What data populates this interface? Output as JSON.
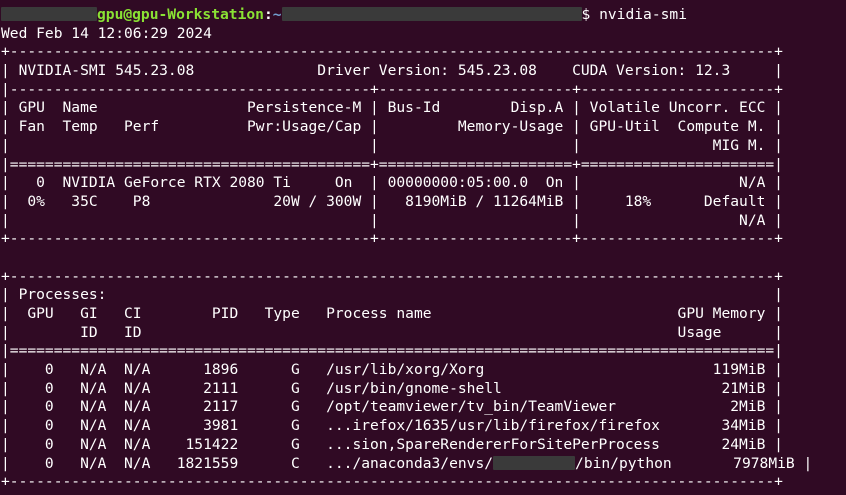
{
  "prompt": {
    "user_host": "gpu@gpu-Workstation",
    "separator": ":",
    "path_prefix": "~",
    "dollar": "$",
    "command": " nvidia-smi"
  },
  "date_line": "Wed Feb 14 12:06:29 2024",
  "lines": {
    "border_top": "+---------------------------------------------------------------------------------------+",
    "header": "| NVIDIA-SMI 545.23.08              Driver Version: 545.23.08    CUDA Version: 12.3     |",
    "sep1": "|-----------------------------------------+----------------------+----------------------+",
    "col_head_1": "| GPU  Name                 Persistence-M | Bus-Id        Disp.A | Volatile Uncorr. ECC |",
    "col_head_2": "| Fan  Temp   Perf          Pwr:Usage/Cap |         Memory-Usage | GPU-Util  Compute M. |",
    "col_head_3": "|                                         |                      |               MIG M. |",
    "sep_eq": "|=========================================+======================+======================|",
    "gpu_row_1": "|   0  NVIDIA GeForce RTX 2080 Ti     On  | 00000000:05:00.0  On |                  N/A |",
    "gpu_row_2": "|  0%   35C    P8              20W / 300W |   8190MiB / 11264MiB |     18%      Default |",
    "gpu_row_3": "|                                         |                      |                  N/A |",
    "border_mid": "+-----------------------------------------+----------------------+----------------------+",
    "blank": "",
    "proc_border_top": "+---------------------------------------------------------------------------------------+",
    "proc_title": "| Processes:                                                                            |",
    "proc_head_1": "|  GPU   GI   CI        PID   Type   Process name                            GPU Memory |",
    "proc_head_2": "|        ID   ID                                                             Usage      |",
    "proc_sep_eq": "|=======================================================================================|",
    "proc_1": "|    0   N/A  N/A      1896      G   /usr/lib/xorg/Xorg                          119MiB |",
    "proc_2": "|    0   N/A  N/A      2111      G   /usr/bin/gnome-shell                         21MiB |",
    "proc_3": "|    0   N/A  N/A      2117      G   /opt/teamviewer/tv_bin/TeamViewer             2MiB |",
    "proc_4": "|    0   N/A  N/A      3981      G   ...irefox/1635/usr/lib/firefox/firefox       34MiB |",
    "proc_5": "|    0   N/A  N/A    151422      G   ...sion,SpareRendererForSitePerProcess       24MiB |",
    "proc_6_pre": "|    0   N/A  N/A   1821559      C   .../anaconda3/envs/",
    "proc_6_post": "/bin/python       7978MiB |",
    "proc_border_bottom": "+---------------------------------------------------------------------------------------+"
  }
}
